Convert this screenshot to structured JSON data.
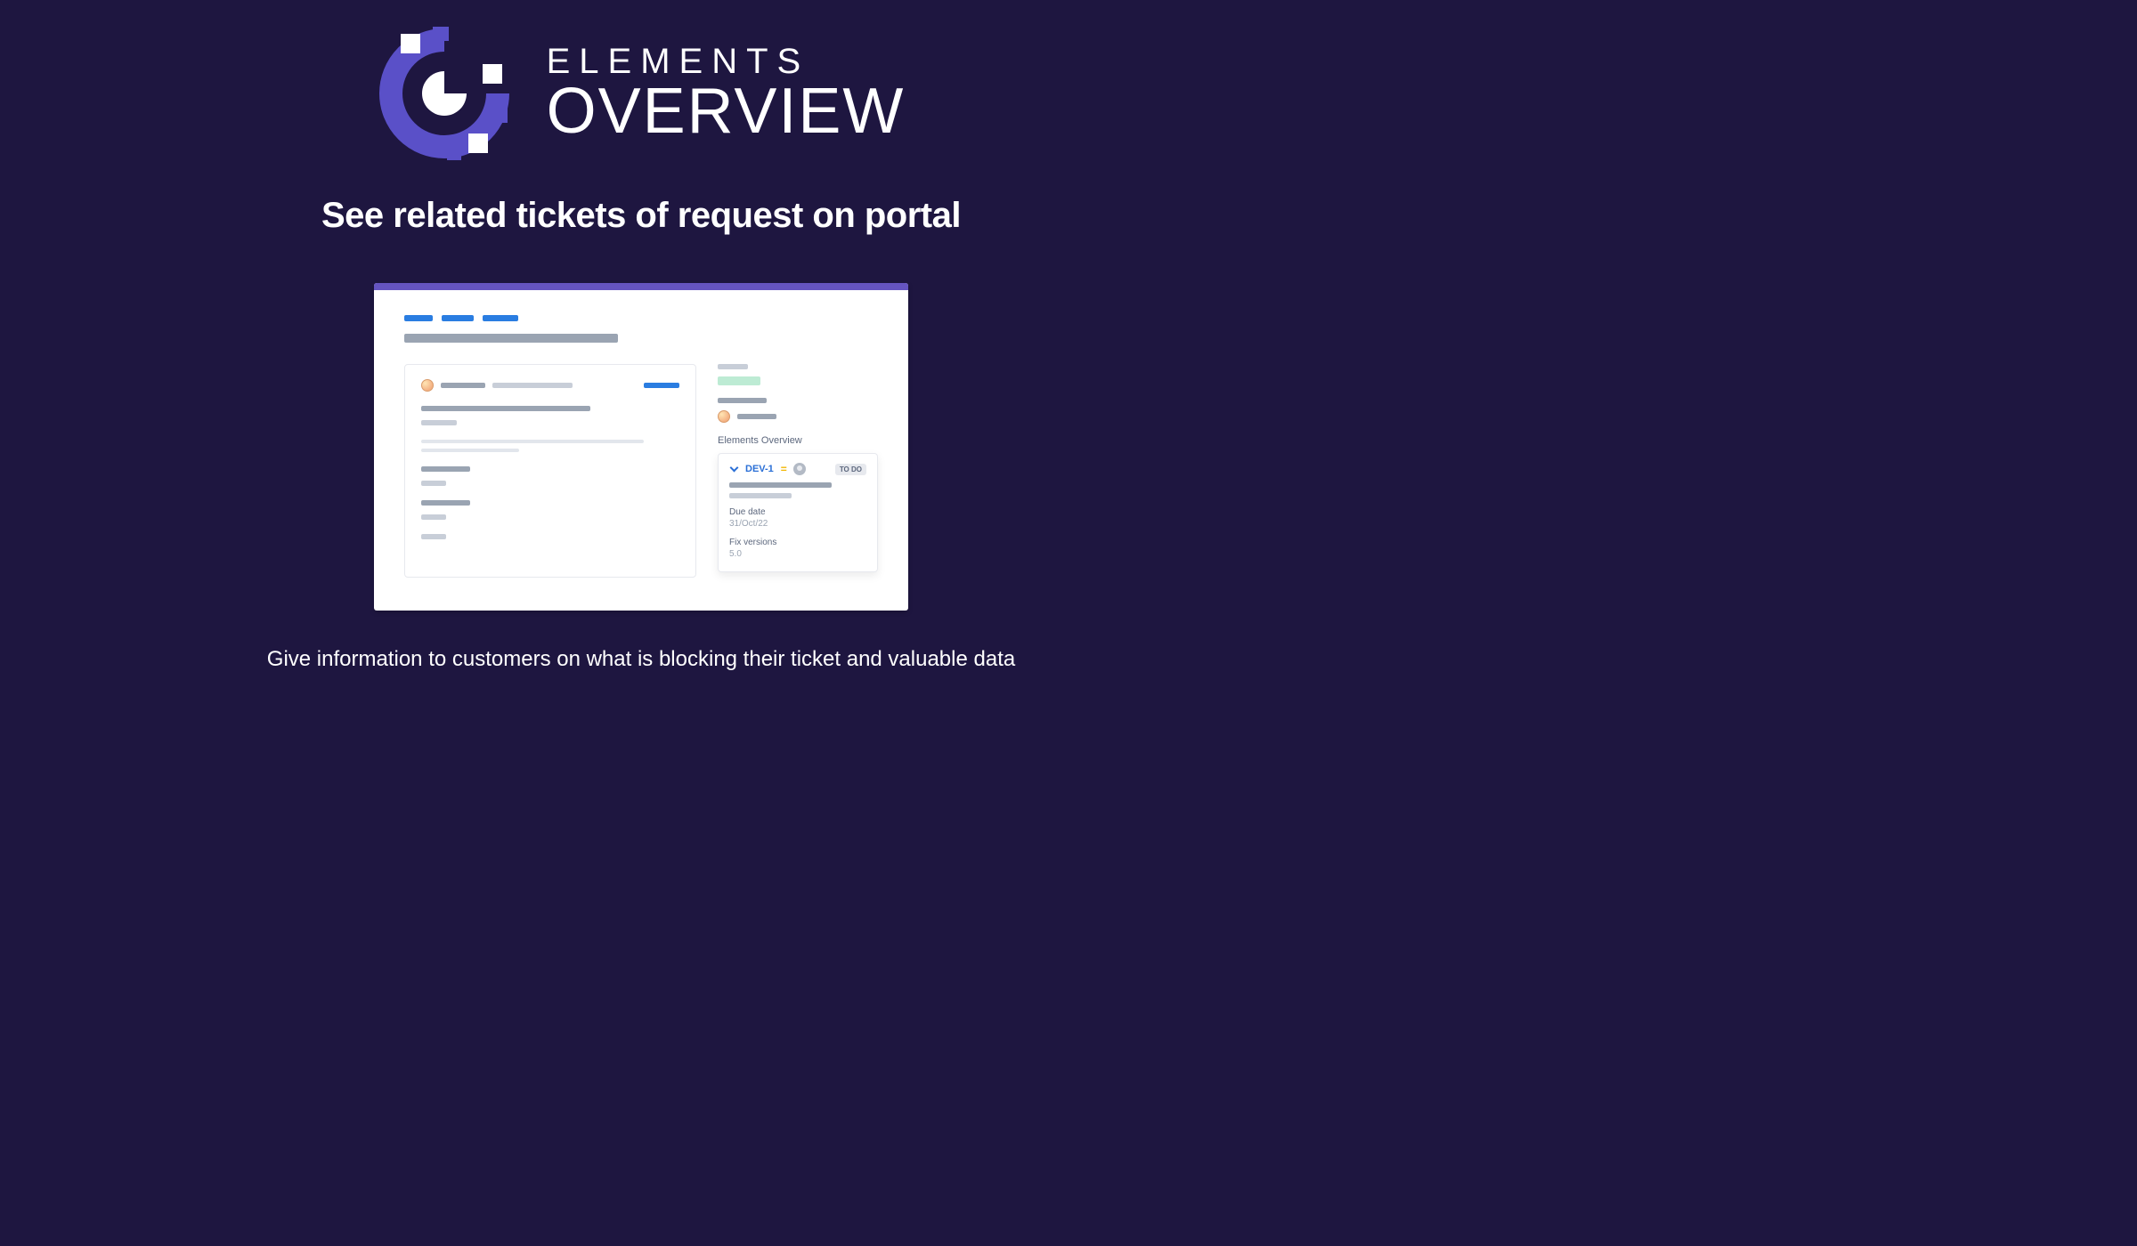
{
  "brand": {
    "top": "ELEMENTS",
    "bottom": "OVERVIEW"
  },
  "headline": "See related tickets of request on portal",
  "caption": "Give information to customers on what is blocking their ticket and valuable data",
  "panel": {
    "section_title": "Elements Overview",
    "ticket": {
      "key": "DEV-1",
      "status": "TO DO",
      "fields": {
        "due_date_label": "Due date",
        "due_date_value": "31/Oct/22",
        "fix_versions_label": "Fix versions",
        "fix_versions_value": "5.0"
      }
    }
  },
  "colors": {
    "page_bg": "#1e1640",
    "brand_accent": "#6554c0",
    "link": "#2a6fd6"
  }
}
